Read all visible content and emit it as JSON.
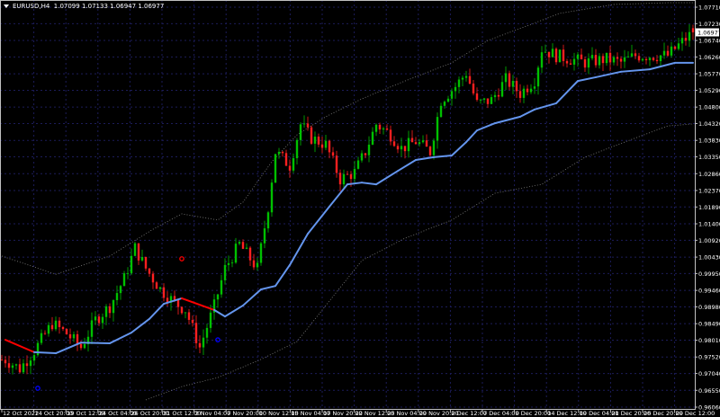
{
  "header": {
    "symbol": "EURUSD,H4",
    "open": "1.07099",
    "high": "1.07133",
    "low": "1.06947",
    "close": "1.06977"
  },
  "colors": {
    "background": "#000000",
    "grid": "#1c1c5a",
    "axis": "#c0c0c0",
    "bull": "#00c000",
    "bear": "#ff2020",
    "ma_up": "#6495ed",
    "ma_down": "#ff0000",
    "bands": "#808080",
    "marker_red": "#ff0000",
    "marker_blue": "#0000ff"
  },
  "chart_data": {
    "type": "candlestick",
    "symbol": "EURUSD",
    "timeframe": "H4",
    "current_price": "1.06977",
    "ylim": [
      0.9606,
      1.0771
    ],
    "y_ticks": [
      "1.07710",
      "1.07230",
      "1.06740",
      "1.06260",
      "1.05770",
      "1.05290",
      "1.04800",
      "1.04320",
      "1.03830",
      "1.03350",
      "1.02860",
      "1.02370",
      "1.01890",
      "1.01400",
      "1.00920",
      "1.00430",
      "0.99950",
      "0.99460",
      "0.98980",
      "0.98490",
      "0.98010",
      "0.97520",
      "0.97040",
      "0.96550",
      "0.96060"
    ],
    "x_ticks": [
      "12 Oct 2022",
      "14 Oct 20:00",
      "19 Oct 12:00",
      "24 Oct 04:00",
      "26 Oct 20:00",
      "31 Oct 12:00",
      "3 Nov 04:00",
      "7 Nov 20:00",
      "10 Nov 12:00",
      "15 Nov 04:00",
      "17 Nov 20:00",
      "22 Nov 12:00",
      "25 Nov 04:00",
      "29 Nov 20:00",
      "2 Dec 12:00",
      "7 Dec 04:00",
      "9 Dec 20:00",
      "14 Dec 12:00",
      "19 Dec 04:00",
      "21 Dec 20:00",
      "26 Dec 20:00",
      "29 Dec 12:00"
    ],
    "grid": true,
    "bar_count": 193,
    "close_path": [
      [
        1,
        0.9744
      ],
      [
        5,
        0.9718
      ],
      [
        9,
        0.977
      ],
      [
        14,
        0.985
      ],
      [
        18,
        0.982
      ],
      [
        22,
        0.978
      ],
      [
        26,
        0.986
      ],
      [
        30,
        0.99
      ],
      [
        34,
        0.998
      ],
      [
        37,
        1.007
      ],
      [
        40,
        1.001
      ],
      [
        44,
        0.995
      ],
      [
        48,
        0.991
      ],
      [
        51,
        0.989
      ],
      [
        55,
        0.978
      ],
      [
        59,
        0.99
      ],
      [
        62,
        1.001
      ],
      [
        66,
        1.008
      ],
      [
        71,
        1.001
      ],
      [
        74,
        1.019
      ],
      [
        76,
        1.035
      ],
      [
        80,
        1.031
      ],
      [
        83,
        1.043
      ],
      [
        86,
        1.039
      ],
      [
        90,
        1.037
      ],
      [
        94,
        1.027
      ],
      [
        98,
        1.029
      ],
      [
        101,
        1.035
      ],
      [
        104,
        1.043
      ],
      [
        108,
        1.04
      ],
      [
        111,
        1.036
      ],
      [
        115,
        1.038
      ],
      [
        119,
        1.035
      ],
      [
        122,
        1.05
      ],
      [
        126,
        1.054
      ],
      [
        129,
        1.058
      ],
      [
        132,
        1.049
      ],
      [
        136,
        1.05
      ],
      [
        140,
        1.056
      ],
      [
        144,
        1.052
      ],
      [
        148,
        1.056
      ],
      [
        150,
        1.065
      ],
      [
        154,
        1.063
      ],
      [
        158,
        1.062
      ],
      [
        162,
        1.061
      ],
      [
        168,
        1.062
      ],
      [
        172,
        1.061
      ],
      [
        176,
        1.063
      ],
      [
        180,
        1.063
      ],
      [
        185,
        1.063
      ],
      [
        189,
        1.067
      ],
      [
        192,
        1.06977
      ]
    ],
    "moving_average": [
      [
        1,
        0.9802
      ],
      [
        9,
        0.9766
      ],
      [
        15,
        0.9763
      ],
      [
        22,
        0.9794
      ],
      [
        30,
        0.9792
      ],
      [
        36,
        0.9823
      ],
      [
        41,
        0.9863
      ],
      [
        45,
        0.9907
      ],
      [
        50,
        0.9923
      ],
      [
        59,
        0.9889
      ],
      [
        62,
        0.987
      ],
      [
        67,
        0.9902
      ],
      [
        72,
        0.9949
      ],
      [
        76,
        0.9959
      ],
      [
        80,
        1.002
      ],
      [
        85,
        1.0111
      ],
      [
        91,
        1.019
      ],
      [
        96,
        1.0255
      ],
      [
        100,
        1.026
      ],
      [
        104,
        1.0255
      ],
      [
        110,
        1.0294
      ],
      [
        115,
        1.0326
      ],
      [
        120,
        1.0334
      ],
      [
        125,
        1.0339
      ],
      [
        129,
        1.0378
      ],
      [
        132,
        1.0412
      ],
      [
        137,
        1.0433
      ],
      [
        144,
        1.0452
      ],
      [
        148,
        1.0473
      ],
      [
        154,
        1.0491
      ],
      [
        160,
        1.0556
      ],
      [
        165,
        1.0567
      ],
      [
        172,
        1.0583
      ],
      [
        180,
        1.059
      ],
      [
        187,
        1.0609
      ],
      [
        192,
        1.0609
      ]
    ],
    "ma_down_ranges": [
      [
        0,
        9
      ],
      [
        49,
        60
      ]
    ],
    "upper_band": [
      [
        0,
        1.0046
      ],
      [
        15,
        0.9993
      ],
      [
        30,
        1.0046
      ],
      [
        42,
        1.0124
      ],
      [
        50,
        1.0169
      ],
      [
        60,
        1.0151
      ],
      [
        67,
        1.0203
      ],
      [
        75,
        1.0321
      ],
      [
        82,
        1.0399
      ],
      [
        90,
        1.0452
      ],
      [
        100,
        1.0504
      ],
      [
        112,
        1.0556
      ],
      [
        125,
        1.0609
      ],
      [
        135,
        1.0674
      ],
      [
        145,
        1.0713
      ],
      [
        155,
        1.0753
      ],
      [
        170,
        1.0779
      ],
      [
        185,
        1.0784
      ],
      [
        192,
        1.0784
      ]
    ],
    "lower_band": [
      [
        40,
        0.9627
      ],
      [
        50,
        0.9666
      ],
      [
        60,
        0.9692
      ],
      [
        72,
        0.9745
      ],
      [
        82,
        0.9797
      ],
      [
        90,
        0.9902
      ],
      [
        100,
        1.0033
      ],
      [
        112,
        1.0098
      ],
      [
        125,
        1.0151
      ],
      [
        137,
        1.0229
      ],
      [
        150,
        1.0255
      ],
      [
        162,
        1.0334
      ],
      [
        175,
        1.0386
      ],
      [
        185,
        1.0425
      ],
      [
        192,
        1.0431
      ]
    ],
    "markers": [
      {
        "bar": 50,
        "price": 1.0038,
        "color": "red"
      },
      {
        "bar": 10,
        "price": 0.9661,
        "color": "blue"
      },
      {
        "bar": 60,
        "price": 0.9802,
        "color": "blue"
      }
    ]
  }
}
